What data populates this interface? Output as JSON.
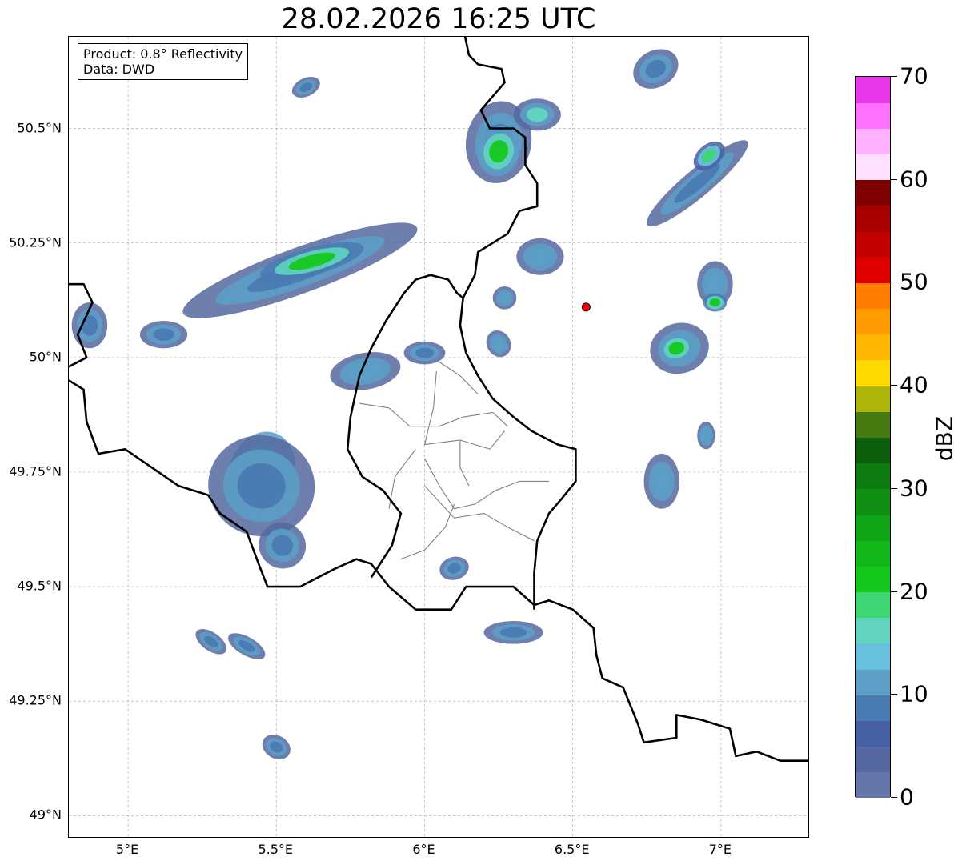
{
  "title": "28.02.2026 16:25 UTC",
  "info": {
    "product": "Product: 0.8° Reflectivity",
    "source": "Data: DWD"
  },
  "lat_ticks": [
    {
      "value": 50.5,
      "label": "50.5°N"
    },
    {
      "value": 50.25,
      "label": "50.25°N"
    },
    {
      "value": 50.0,
      "label": "50°N"
    },
    {
      "value": 49.75,
      "label": "49.75°N"
    },
    {
      "value": 49.5,
      "label": "49.5°N"
    },
    {
      "value": 49.25,
      "label": "49.25°N"
    },
    {
      "value": 49.0,
      "label": "49°N"
    }
  ],
  "lon_ticks": [
    {
      "value": 5.0,
      "label": "5°E"
    },
    {
      "value": 5.5,
      "label": "5.5°E"
    },
    {
      "value": 6.0,
      "label": "6°E"
    },
    {
      "value": 6.5,
      "label": "6.5°E"
    },
    {
      "value": 7.0,
      "label": "7°E"
    }
  ],
  "extent": {
    "lon_min": 4.8,
    "lon_max": 7.3,
    "lat_min": 48.95,
    "lat_max": 50.7
  },
  "colorbar": {
    "label": "dBZ",
    "vmin": 0,
    "vmax": 70,
    "ticks": [
      "0",
      "10",
      "20",
      "30",
      "40",
      "50",
      "60",
      "70"
    ],
    "colors": [
      "#6476a8",
      "#5568a0",
      "#4660a4",
      "#4a7ab2",
      "#5b9ec6",
      "#68c1dc",
      "#61d4c0",
      "#3dd673",
      "#14c71b",
      "#11b817",
      "#10a514",
      "#0f9012",
      "#0c7c10",
      "#0a5e0c",
      "#477a10",
      "#adb40a",
      "#ffd800",
      "#ffb600",
      "#ff9a00",
      "#ff7c00",
      "#e10000",
      "#c50000",
      "#a80000",
      "#7f0000",
      "#ffe0ff",
      "#ffb0ff",
      "#ff70ff",
      "#ea36ea"
    ]
  },
  "marker": {
    "lon": 6.545,
    "lat": 50.11,
    "color": "#ff0000"
  },
  "echoes": [
    {
      "lon": 5.45,
      "lat": 49.75,
      "rx": 0.11,
      "ry": 0.09,
      "rot": 20,
      "dbz": 22
    },
    {
      "lon": 5.45,
      "lat": 49.72,
      "rx": 0.18,
      "ry": 0.11,
      "rot": 10,
      "dbz": 8
    },
    {
      "lon": 5.52,
      "lat": 49.59,
      "rx": 0.08,
      "ry": 0.05,
      "rot": 30,
      "dbz": 8
    },
    {
      "lon": 5.58,
      "lat": 50.19,
      "rx": 0.42,
      "ry": 0.05,
      "rot": -20,
      "dbz": 8
    },
    {
      "lon": 5.62,
      "lat": 50.21,
      "rx": 0.18,
      "ry": 0.03,
      "rot": -15,
      "dbz": 20
    },
    {
      "lon": 5.12,
      "lat": 50.05,
      "rx": 0.08,
      "ry": 0.03,
      "rot": 0,
      "dbz": 8
    },
    {
      "lon": 5.8,
      "lat": 49.97,
      "rx": 0.12,
      "ry": 0.04,
      "rot": -10,
      "dbz": 12
    },
    {
      "lon": 6.0,
      "lat": 50.01,
      "rx": 0.07,
      "ry": 0.025,
      "rot": 0,
      "dbz": 8
    },
    {
      "lon": 6.25,
      "lat": 50.47,
      "rx": 0.11,
      "ry": 0.09,
      "rot": 10,
      "dbz": 8
    },
    {
      "lon": 6.25,
      "lat": 50.45,
      "rx": 0.07,
      "ry": 0.055,
      "rot": 15,
      "dbz": 22
    },
    {
      "lon": 6.38,
      "lat": 50.53,
      "rx": 0.08,
      "ry": 0.035,
      "rot": 0,
      "dbz": 15
    },
    {
      "lon": 6.39,
      "lat": 50.22,
      "rx": 0.08,
      "ry": 0.04,
      "rot": 0,
      "dbz": 12
    },
    {
      "lon": 6.27,
      "lat": 50.13,
      "rx": 0.04,
      "ry": 0.025,
      "rot": 0,
      "dbz": 10
    },
    {
      "lon": 6.25,
      "lat": 50.03,
      "rx": 0.04,
      "ry": 0.03,
      "rot": -30,
      "dbz": 12
    },
    {
      "lon": 6.86,
      "lat": 50.02,
      "rx": 0.1,
      "ry": 0.055,
      "rot": -15,
      "dbz": 10
    },
    {
      "lon": 6.85,
      "lat": 50.02,
      "rx": 0.06,
      "ry": 0.03,
      "rot": -15,
      "dbz": 22
    },
    {
      "lon": 6.92,
      "lat": 50.38,
      "rx": 0.22,
      "ry": 0.03,
      "rot": -40,
      "dbz": 8
    },
    {
      "lon": 6.96,
      "lat": 50.44,
      "rx": 0.06,
      "ry": 0.025,
      "rot": -40,
      "dbz": 18
    },
    {
      "lon": 6.78,
      "lat": 50.63,
      "rx": 0.08,
      "ry": 0.04,
      "rot": -30,
      "dbz": 8
    },
    {
      "lon": 6.98,
      "lat": 50.16,
      "rx": 0.06,
      "ry": 0.05,
      "rot": 0,
      "dbz": 12
    },
    {
      "lon": 6.8,
      "lat": 49.73,
      "rx": 0.06,
      "ry": 0.06,
      "rot": 0,
      "dbz": 10
    },
    {
      "lon": 6.95,
      "lat": 49.83,
      "rx": 0.03,
      "ry": 0.03,
      "rot": 0,
      "dbz": 10
    },
    {
      "lon": 6.3,
      "lat": 49.4,
      "rx": 0.1,
      "ry": 0.025,
      "rot": 0,
      "dbz": 8
    },
    {
      "lon": 6.1,
      "lat": 49.54,
      "rx": 0.05,
      "ry": 0.025,
      "rot": -15,
      "dbz": 8
    },
    {
      "lon": 5.4,
      "lat": 49.37,
      "rx": 0.07,
      "ry": 0.02,
      "rot": 30,
      "dbz": 8
    },
    {
      "lon": 5.28,
      "lat": 49.38,
      "rx": 0.06,
      "ry": 0.02,
      "rot": 35,
      "dbz": 8
    },
    {
      "lon": 5.5,
      "lat": 49.15,
      "rx": 0.05,
      "ry": 0.025,
      "rot": 30,
      "dbz": 8
    },
    {
      "lon": 5.6,
      "lat": 50.59,
      "rx": 0.05,
      "ry": 0.02,
      "rot": -25,
      "dbz": 8
    },
    {
      "lon": 4.87,
      "lat": 50.07,
      "rx": 0.06,
      "ry": 0.05,
      "rot": 0,
      "dbz": 8
    },
    {
      "lon": 6.98,
      "lat": 50.12,
      "rx": 0.04,
      "ry": 0.02,
      "rot": 0,
      "dbz": 20
    }
  ],
  "borders": {
    "main": [
      [
        [
          6.13,
          50.72
        ],
        [
          6.15,
          50.66
        ],
        [
          6.18,
          50.64
        ],
        [
          6.26,
          50.63
        ],
        [
          6.27,
          50.6
        ],
        [
          6.19,
          50.54
        ],
        [
          6.22,
          50.5
        ],
        [
          6.3,
          50.5
        ],
        [
          6.34,
          50.48
        ],
        [
          6.34,
          50.42
        ],
        [
          6.38,
          50.38
        ],
        [
          6.38,
          50.33
        ],
        [
          6.32,
          50.32
        ],
        [
          6.28,
          50.27
        ],
        [
          6.18,
          50.23
        ],
        [
          6.17,
          50.18
        ],
        [
          6.13,
          50.13
        ],
        [
          6.12,
          50.07
        ],
        [
          6.14,
          50.01
        ],
        [
          6.18,
          49.96
        ],
        [
          6.23,
          49.91
        ],
        [
          6.3,
          49.87
        ],
        [
          6.36,
          49.84
        ],
        [
          6.45,
          49.81
        ],
        [
          6.51,
          49.8
        ],
        [
          6.51,
          49.73
        ],
        [
          6.46,
          49.69
        ],
        [
          6.42,
          49.66
        ],
        [
          6.38,
          49.6
        ],
        [
          6.37,
          49.53
        ],
        [
          6.37,
          49.45
        ]
      ],
      [
        [
          6.37,
          49.46
        ],
        [
          6.3,
          49.5
        ],
        [
          6.23,
          49.5
        ],
        [
          6.14,
          49.5
        ],
        [
          6.09,
          49.45
        ],
        [
          5.97,
          49.45
        ],
        [
          5.88,
          49.5
        ],
        [
          5.82,
          49.55
        ],
        [
          5.77,
          49.56
        ],
        [
          5.7,
          49.54
        ],
        [
          5.58,
          49.5
        ],
        [
          5.47,
          49.5
        ],
        [
          5.44,
          49.55
        ],
        [
          5.4,
          49.62
        ],
        [
          5.31,
          49.66
        ],
        [
          5.27,
          49.7
        ],
        [
          5.17,
          49.72
        ],
        [
          5.08,
          49.76
        ],
        [
          4.99,
          49.8
        ],
        [
          4.9,
          49.79
        ],
        [
          4.86,
          49.86
        ],
        [
          4.85,
          49.93
        ],
        [
          4.8,
          49.95
        ]
      ],
      [
        [
          6.37,
          49.46
        ],
        [
          6.42,
          49.47
        ],
        [
          6.5,
          49.45
        ],
        [
          6.57,
          49.41
        ],
        [
          6.58,
          49.35
        ],
        [
          6.6,
          49.3
        ],
        [
          6.67,
          49.28
        ],
        [
          6.72,
          49.2
        ],
        [
          6.74,
          49.16
        ],
        [
          6.85,
          49.17
        ],
        [
          6.85,
          49.22
        ],
        [
          6.93,
          49.21
        ],
        [
          7.03,
          49.19
        ],
        [
          7.05,
          49.13
        ],
        [
          7.12,
          49.14
        ],
        [
          7.2,
          49.12
        ],
        [
          7.3,
          49.12
        ]
      ],
      [
        [
          6.02,
          50.18
        ],
        [
          5.97,
          50.17
        ],
        [
          5.93,
          50.14
        ],
        [
          5.87,
          50.08
        ],
        [
          5.82,
          50.02
        ],
        [
          5.78,
          49.96
        ],
        [
          5.75,
          49.87
        ],
        [
          5.74,
          49.8
        ],
        [
          5.79,
          49.74
        ],
        [
          5.86,
          49.71
        ],
        [
          5.92,
          49.66
        ],
        [
          5.89,
          49.59
        ],
        [
          5.85,
          49.55
        ],
        [
          5.82,
          49.52
        ]
      ],
      [
        [
          6.02,
          50.18
        ],
        [
          6.08,
          50.17
        ],
        [
          6.11,
          50.14
        ],
        [
          6.13,
          50.13
        ]
      ],
      [
        [
          4.8,
          50.16
        ],
        [
          4.85,
          50.16
        ],
        [
          4.88,
          50.12
        ],
        [
          4.83,
          50.05
        ],
        [
          4.86,
          50.0
        ],
        [
          4.8,
          49.98
        ]
      ]
    ],
    "internal": [
      [
        [
          5.78,
          49.9
        ],
        [
          5.88,
          49.89
        ],
        [
          5.95,
          49.85
        ],
        [
          6.05,
          49.85
        ],
        [
          6.13,
          49.87
        ],
        [
          6.23,
          49.88
        ],
        [
          6.28,
          49.85
        ]
      ],
      [
        [
          6.04,
          49.97
        ],
        [
          6.03,
          49.89
        ],
        [
          6.0,
          49.81
        ],
        [
          6.12,
          49.82
        ],
        [
          6.22,
          49.8
        ],
        [
          6.27,
          49.84
        ]
      ],
      [
        [
          5.97,
          49.8
        ],
        [
          5.9,
          49.74
        ],
        [
          5.88,
          49.67
        ]
      ],
      [
        [
          6.0,
          49.78
        ],
        [
          6.05,
          49.72
        ],
        [
          6.1,
          49.67
        ],
        [
          6.17,
          49.68
        ],
        [
          6.24,
          49.71
        ],
        [
          6.32,
          49.73
        ],
        [
          6.42,
          49.73
        ]
      ],
      [
        [
          6.0,
          49.72
        ],
        [
          6.1,
          49.65
        ],
        [
          6.2,
          49.66
        ],
        [
          6.28,
          49.63
        ],
        [
          6.37,
          49.6
        ]
      ],
      [
        [
          5.92,
          49.56
        ],
        [
          6.0,
          49.58
        ],
        [
          6.07,
          49.63
        ],
        [
          6.1,
          49.68
        ]
      ],
      [
        [
          6.12,
          49.82
        ],
        [
          6.12,
          49.76
        ],
        [
          6.15,
          49.72
        ]
      ],
      [
        [
          6.05,
          49.99
        ],
        [
          6.12,
          49.96
        ],
        [
          6.18,
          49.92
        ]
      ]
    ]
  }
}
